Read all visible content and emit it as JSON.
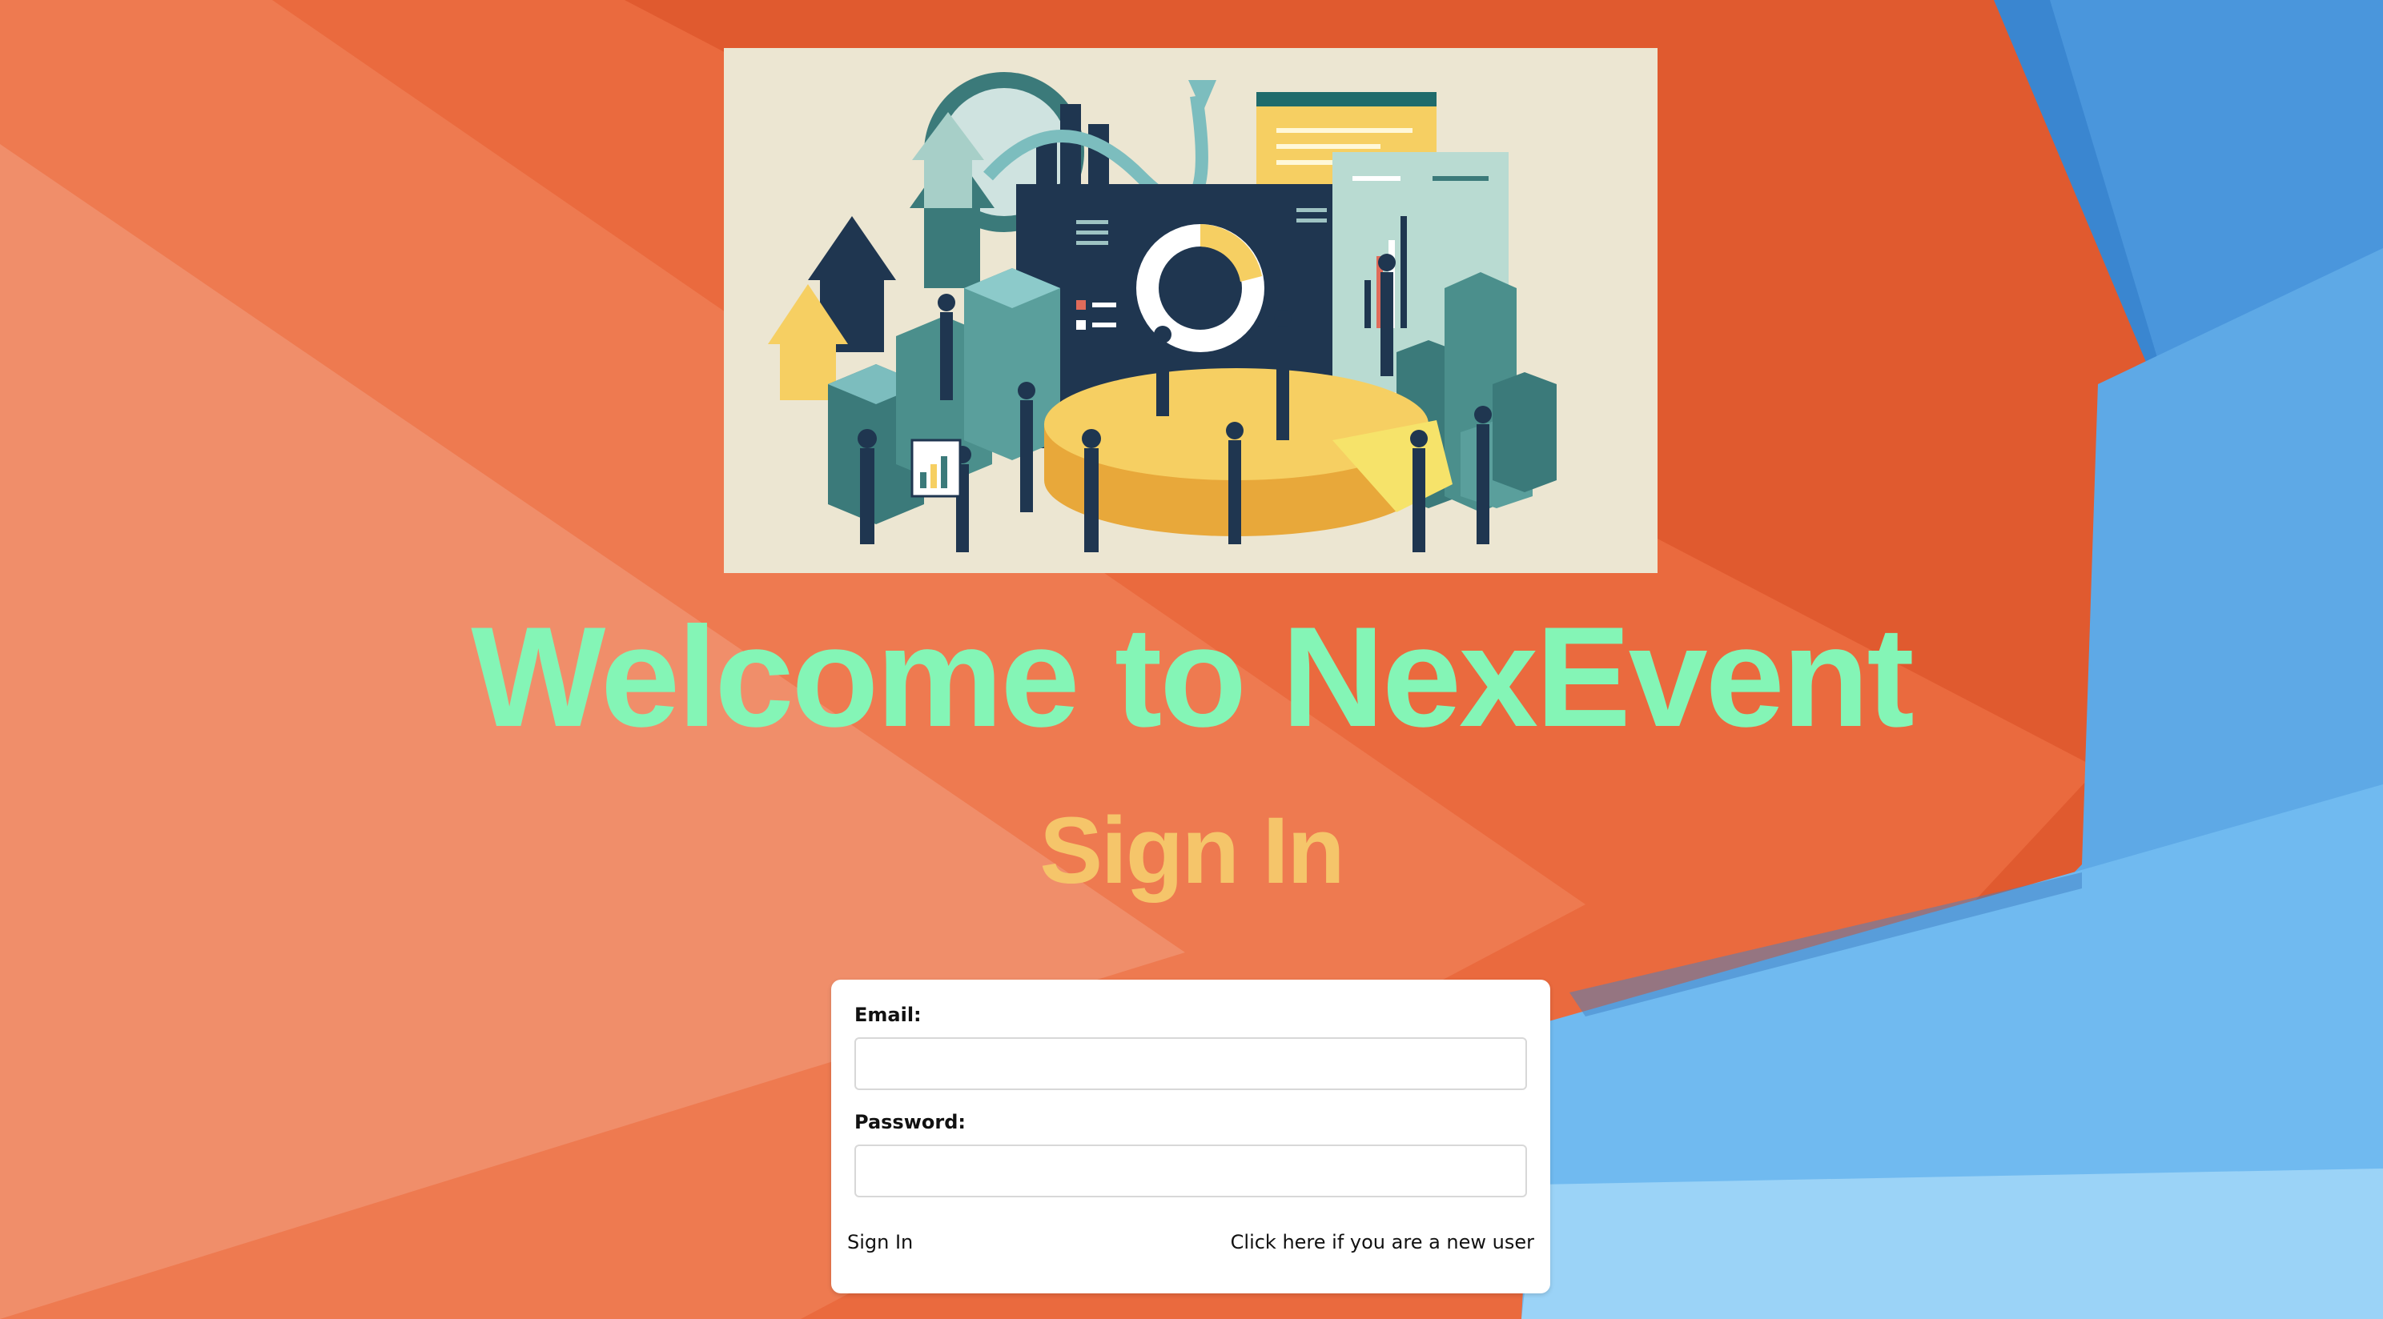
{
  "welcome_title": "Welcome to NexEvent",
  "signin_heading": "Sign In",
  "form": {
    "email_label": "Email:",
    "email_value": "",
    "password_label": "Password:",
    "password_value": "",
    "submit_label": "Sign In",
    "register_link": "Click here if you are a new user"
  },
  "colors": {
    "welcome_title": "#84f5b6",
    "signin_heading": "#f5c56a",
    "card": "#ffffff",
    "background_orange": "#e35a30",
    "background_blue": "#4aa3e8"
  }
}
